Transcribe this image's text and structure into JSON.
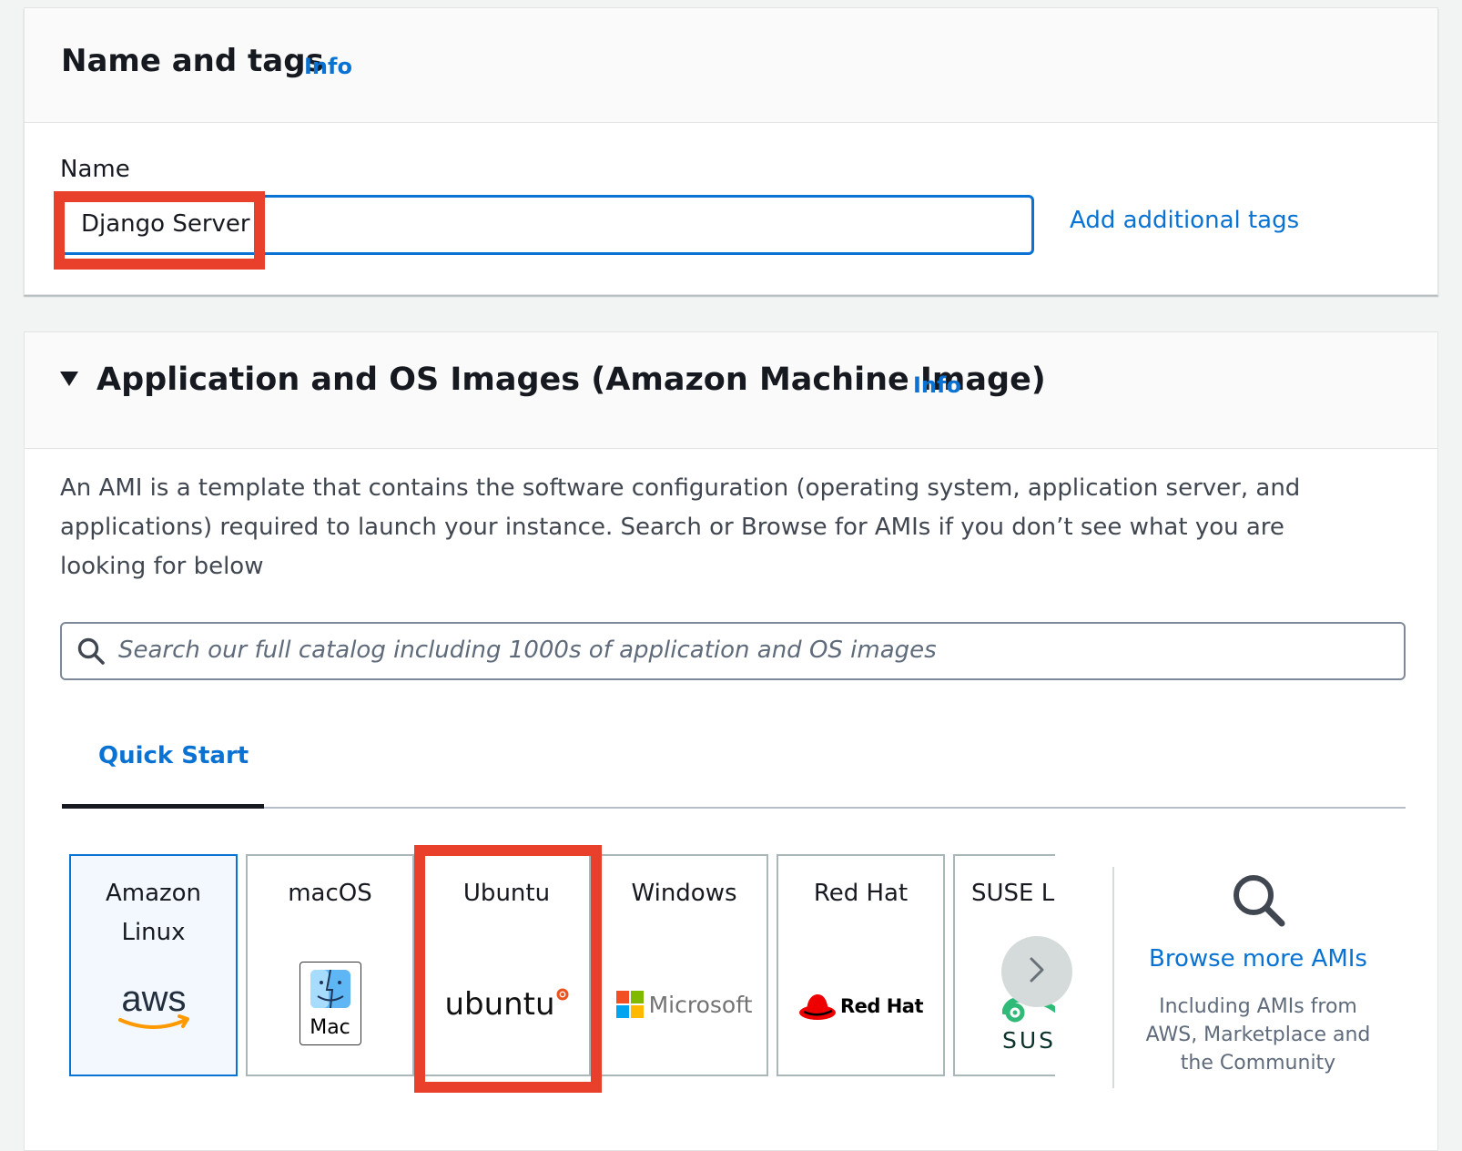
{
  "name_and_tags": {
    "title": "Name and tags",
    "info": "Info",
    "name_label": "Name",
    "name_value": "Django Server",
    "add_tags": "Add additional tags"
  },
  "ami": {
    "title": "Application and OS Images (Amazon Machine Image)",
    "info": "Info",
    "description": "An AMI is a template that contains the software configuration (operating system, application server, and applications) required to launch your instance. Search or Browse for AMIs if you don’t see what you are looking for below",
    "search_placeholder": "Search our full catalog including 1000s of application and OS images",
    "tab": "Quick Start",
    "tiles": [
      {
        "label": "Amazon Linux",
        "logo_text": "aws",
        "selected": true
      },
      {
        "label": "macOS",
        "logo_text": "Mac"
      },
      {
        "label": "Ubuntu",
        "logo_text": "ubuntu"
      },
      {
        "label": "Windows",
        "logo_text": "Microsoft"
      },
      {
        "label": "Red Hat",
        "logo_text": "Red Hat"
      },
      {
        "label": "SUSE Li",
        "logo_text": "SUS"
      }
    ],
    "browse": {
      "title": "Browse more AMIs",
      "subtitle": "Including AMIs from AWS, Marketplace and the Community"
    }
  },
  "colors": {
    "link": "#0972d3",
    "highlight": "#e8402a",
    "selected_tile_bg": "#f2f8fd",
    "ubuntu_orange": "#e95420",
    "redhat_red": "#ee0000",
    "aws_orange": "#ff9900"
  },
  "icons": [
    "caret-down-icon",
    "search-icon",
    "chevron-right-icon",
    "aws-logo",
    "mac-finder-logo",
    "ubuntu-logo",
    "microsoft-logo",
    "redhat-logo",
    "suse-logo"
  ]
}
